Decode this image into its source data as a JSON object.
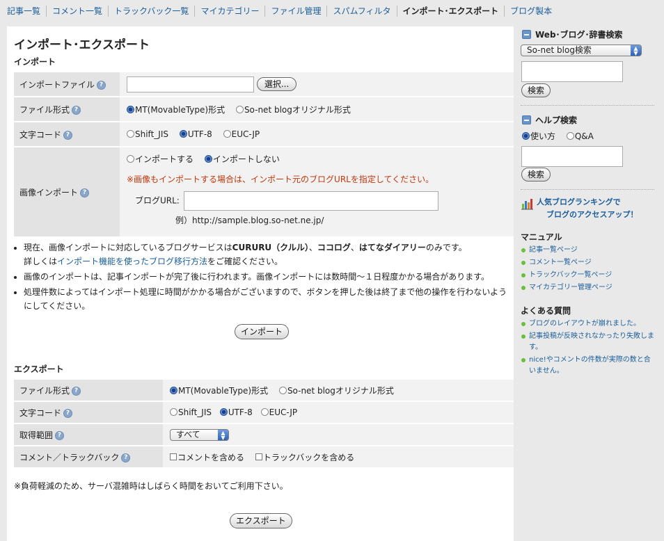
{
  "nav": {
    "tabs": [
      {
        "label": "記事一覧"
      },
      {
        "label": "コメント一覧"
      },
      {
        "label": "トラックバック一覧"
      },
      {
        "label": "マイカテゴリー"
      },
      {
        "label": "ファイル管理"
      },
      {
        "label": "スパムフィルタ"
      },
      {
        "label": "インポート･エクスポート",
        "active": true
      },
      {
        "label": "ブログ製本"
      }
    ]
  },
  "page": {
    "title": "インポート･エクスポート"
  },
  "import": {
    "section_title": "インポート",
    "file": {
      "label": "インポートファイル",
      "value": "",
      "button": "選択..."
    },
    "format": {
      "label": "ファイル形式",
      "options": [
        "MT(MovableType)形式",
        "So-net blogオリジナル形式"
      ],
      "selected": 0
    },
    "charset": {
      "label": "文字コード",
      "options": [
        "Shift_JIS",
        "UTF-8",
        "EUC-JP"
      ],
      "selected": 1
    },
    "image": {
      "label": "画像インポート",
      "options": [
        "インポートする",
        "インポートしない"
      ],
      "selected": 1,
      "warning": "※画像もインポートする場合は、インポート元のブログURLを指定してください。",
      "url_label": "ブログURL:",
      "url_value": "",
      "example": "例）http://sample.blog.so-net.ne.jp/"
    },
    "notes": {
      "n1_pre": "現在、画像インポートに対応しているブログサービスは",
      "n1_b1": "CURURU（クルル）",
      "n1_sep1": "、",
      "n1_b2": "ココログ",
      "n1_sep2": "、",
      "n1_b3": "はてなダイアリー",
      "n1_post": "のみです。",
      "n1_line2_pre": "詳しくは",
      "n1_link": "インポート機能を使ったブログ移行方法",
      "n1_line2_post": "をご確認ください。",
      "n2": "画像のインポートは、記事インポートが完了後に行われます。画像インポートには数時間〜１日程度かかる場合があります。",
      "n3": "処理件数によってはインポート処理に時間がかかる場合がございますので、ボタンを押した後は終了まで他の操作を行わないようにしてください。"
    },
    "submit": "インポート"
  },
  "export": {
    "section_title": "エクスポート",
    "format": {
      "label": "ファイル形式",
      "options": [
        "MT(MovableType)形式",
        "So-net blogオリジナル形式"
      ],
      "selected": 0
    },
    "charset": {
      "label": "文字コード",
      "options": [
        "Shift_JIS",
        "UTF-8",
        "EUC-JP"
      ],
      "selected": 1
    },
    "range": {
      "label": "取得範囲",
      "selected": "すべて"
    },
    "include": {
      "label": "コメント／トラックバック",
      "options": [
        "コメントを含める",
        "トラックバックを含める"
      ]
    },
    "note": "※負荷軽減のため、サーバ混雑時はしばらく時間をおいてご利用下さい。",
    "submit": "エクスポート"
  },
  "sidebar": {
    "web_search": {
      "title": "Web･ブログ･辞書検索",
      "select": "So-net blog検索",
      "value": "",
      "button": "検索"
    },
    "help_search": {
      "title": "ヘルプ検索",
      "options": [
        "使い方",
        "Q&A"
      ],
      "selected": 0,
      "value": "",
      "button": "検索"
    },
    "ranking": {
      "line1": "人気ブログランキングで",
      "line2": "ブログのアクセスアップ！"
    },
    "manual": {
      "title": "マニュアル",
      "items": [
        "記事一覧ページ",
        "コメント一覧ページ",
        "トラックバック一覧ページ",
        "マイカテゴリー管理ページ"
      ]
    },
    "faq": {
      "title": "よくある質問",
      "items": [
        "ブログのレイアウトが崩れました。",
        "記事投稿が反映されなかったり失敗します。",
        "nice!やコメントの件数が実際の数と合いません。"
      ]
    }
  },
  "colors": {
    "link": "#1a5d9a",
    "warning": "#c0360c",
    "accent": "#6a95c9",
    "bullet": "#6bbf3a"
  }
}
